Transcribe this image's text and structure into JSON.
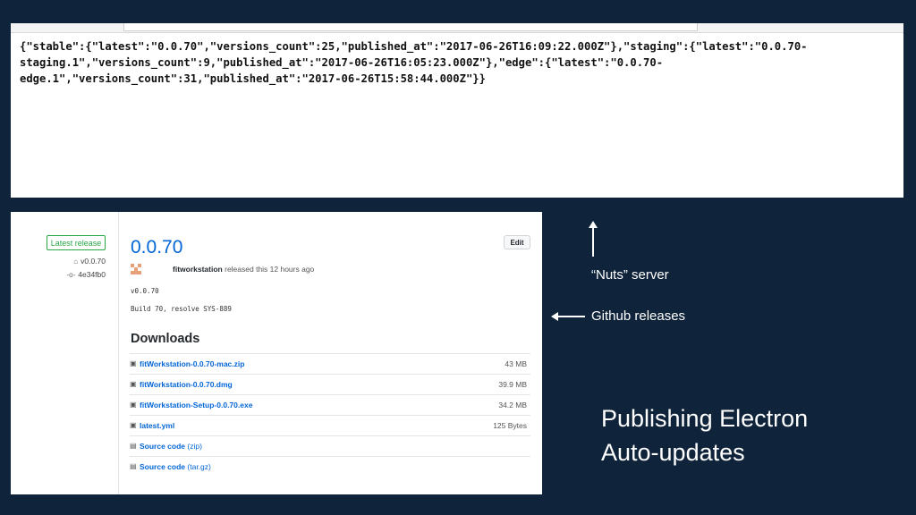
{
  "json_response": {
    "line1": "{\"stable\":{\"latest\":\"0.0.70\",\"versions_count\":25,\"published_at\":\"2017-06-26T16:09:22.000Z\"},\"staging\":{\"latest\":\"0.0.70-",
    "line2": "staging.1\",\"versions_count\":9,\"published_at\":\"2017-06-26T16:05:23.000Z\"},\"edge\":{\"latest\":\"0.0.70-",
    "line3": "edge.1\",\"versions_count\":31,\"published_at\":\"2017-06-26T15:58:44.000Z\"}}"
  },
  "release": {
    "badge": "Latest release",
    "tag": "v0.0.70",
    "commit": "4e34fb0",
    "title": "0.0.70",
    "edit_label": "Edit",
    "author": "fitworkstation",
    "meta": "released this 12 hours ago",
    "body_line1": "v0.0.70",
    "body_line2": "Build 70, resolve SYS-889",
    "downloads_title": "Downloads",
    "assets": [
      {
        "icon": "package-icon",
        "name": "fitWorkstation-0.0.70-mac.zip",
        "sub": "",
        "size": "43 MB"
      },
      {
        "icon": "package-icon",
        "name": "fitWorkstation-0.0.70.dmg",
        "sub": "",
        "size": "39.9 MB"
      },
      {
        "icon": "package-icon",
        "name": "fitWorkstation-Setup-0.0.70.exe",
        "sub": "",
        "size": "34.2 MB"
      },
      {
        "icon": "package-icon",
        "name": "latest.yml",
        "sub": "",
        "size": "125 Bytes"
      },
      {
        "icon": "zip-icon",
        "name": "Source code",
        "sub": "(zip)",
        "size": ""
      },
      {
        "icon": "zip-icon",
        "name": "Source code",
        "sub": "(tar.gz)",
        "size": ""
      }
    ]
  },
  "annotations": {
    "nuts_server": "“Nuts” server",
    "github_releases": "Github releases"
  },
  "slide_title": {
    "line1": "Publishing Electron",
    "line2": "Auto-updates"
  },
  "colors": {
    "background": "#0f243b",
    "link": "#0366d6",
    "badge_green": "#28a745"
  }
}
